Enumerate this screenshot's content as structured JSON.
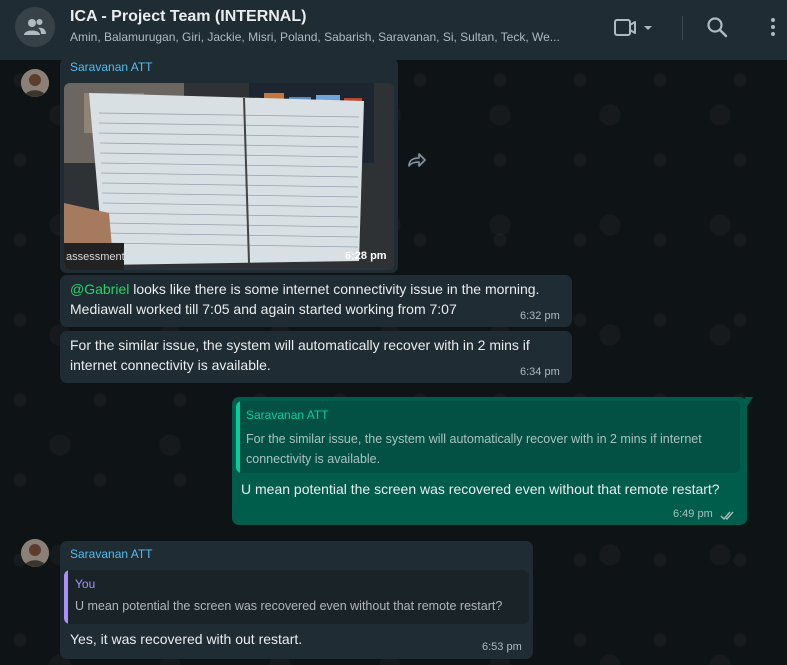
{
  "header": {
    "title": "ICA - Project Team (INTERNAL)",
    "members": "Amin, Balamurugan, Giri, Jackie, Misri, Poland, Sabarish, Saravanan, Si, Sultan, Teck, We...",
    "icons": [
      "group-icon",
      "video-call-icon",
      "dropdown-caret-icon",
      "search-icon",
      "menu-icon"
    ]
  },
  "messages": [
    {
      "sender": "Saravanan ATT",
      "image_caption": "assessment",
      "time": "6:28 pm"
    },
    {
      "mention": "@Gabriel",
      "text_rest": " looks like there is some internet connectivity issue in the morning.",
      "text_line2": "Mediawall worked till 7:05 and again started working from 7:07",
      "time": "6:32 pm"
    },
    {
      "text": "For the similar issue, the system will automatically recover with in 2 mins if internet connectivity is available.",
      "time": "6:34 pm"
    },
    {
      "quote_sender": "Saravanan ATT",
      "quote_text": "For the similar issue, the system will automatically recover with in 2 mins if internet connectivity is available.",
      "text": "U mean potential the screen was recovered even without that remote restart?",
      "time": "6:49 pm"
    },
    {
      "sender": "Saravanan ATT",
      "quote_sender": "You",
      "quote_text": "U mean potential the screen was recovered even without that remote restart?",
      "text": "Yes, it was recovered with out restart.",
      "time": "6:53 pm"
    }
  ],
  "colors": {
    "header_bg": "#202c33",
    "incoming_bubble": "#202c33",
    "outgoing_bubble": "#005c4b",
    "accent_green": "#25d366",
    "quote_purple": "#a991f7"
  }
}
